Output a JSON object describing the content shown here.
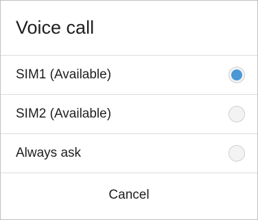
{
  "dialog": {
    "title": "Voice call",
    "options": [
      {
        "label": "SIM1 (Available)",
        "selected": true
      },
      {
        "label": "SIM2 (Available)",
        "selected": false
      },
      {
        "label": "Always ask",
        "selected": false
      }
    ],
    "cancel_label": "Cancel"
  },
  "colors": {
    "accent": "#4a98d6",
    "divider": "#dcdcdc",
    "text": "#1e1e1e"
  }
}
